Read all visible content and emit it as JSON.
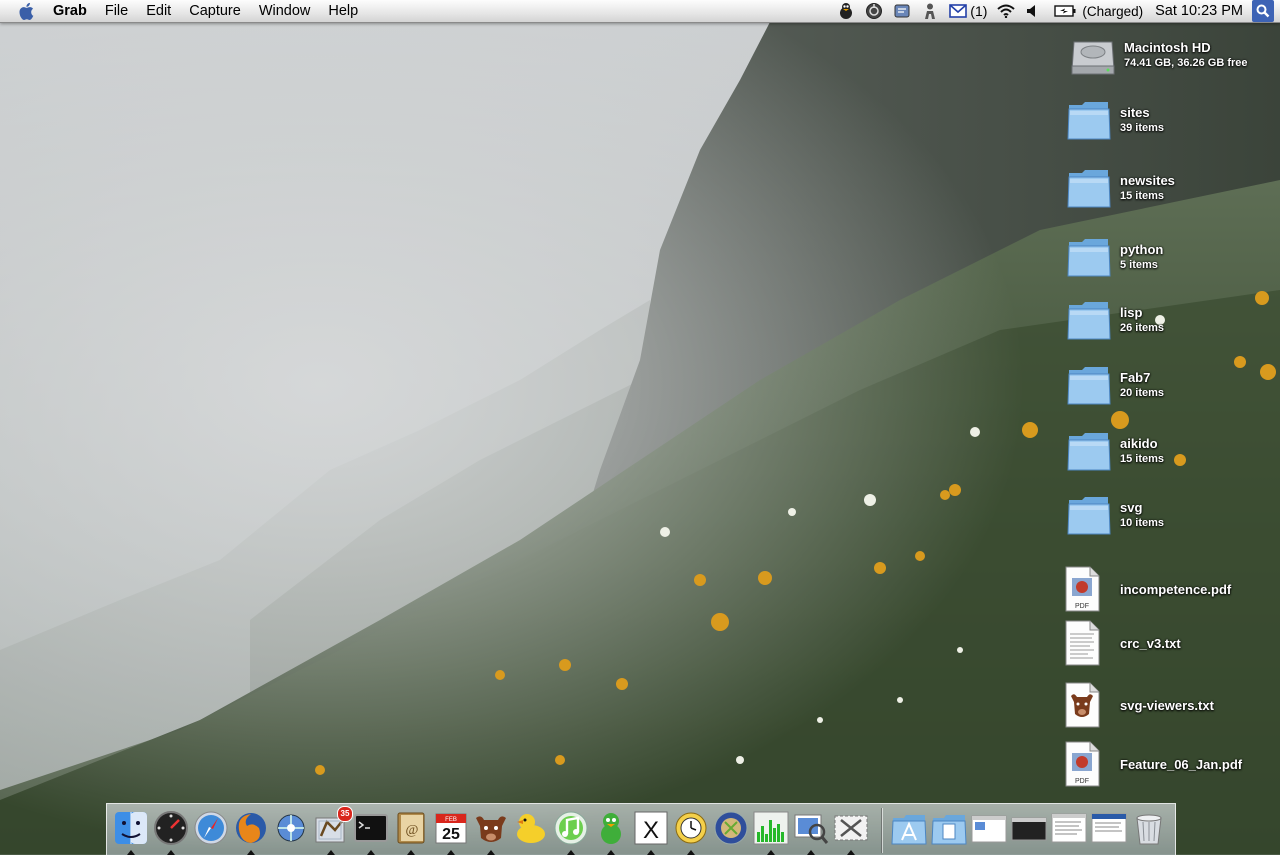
{
  "menubar": {
    "items": [
      "Grab",
      "File",
      "Edit",
      "Capture",
      "Window",
      "Help"
    ],
    "mail_count": "(1)",
    "battery_text": "(Charged)",
    "clock": "Sat 10:23 PM"
  },
  "desktop": {
    "drive": {
      "name": "Macintosh HD",
      "info": "74.41 GB, 36.26 GB free"
    },
    "folders": [
      {
        "name": "sites",
        "info": "39 items"
      },
      {
        "name": "newsites",
        "info": "15 items"
      },
      {
        "name": "python",
        "info": "5 items"
      },
      {
        "name": "lisp",
        "info": "26 items"
      },
      {
        "name": "Fab7",
        "info": "20 items"
      },
      {
        "name": "aikido",
        "info": "15 items"
      },
      {
        "name": "svg",
        "info": "10 items"
      }
    ],
    "files": [
      {
        "name": "incompetence.pdf",
        "icon": "pdf-icon",
        "badge": "PDF"
      },
      {
        "name": "crc_v3.txt",
        "icon": "text-file-icon"
      },
      {
        "name": "svg-viewers.txt",
        "icon": "bull-document-icon"
      },
      {
        "name": "Feature_06_Jan.pdf",
        "icon": "pdf-icon",
        "badge": "PDF"
      }
    ]
  },
  "dock": {
    "ical_month": "FEB",
    "ical_day": "25",
    "mail_badge": "35",
    "x11_label": "X",
    "apps": [
      "finder-icon",
      "dashboard-icon",
      "safari-icon",
      "firefox-icon",
      "network-utility-icon",
      "mail-icon",
      "terminal-icon",
      "address-book-icon",
      "ical-icon",
      "bull-app-icon",
      "cyberduck-icon",
      "itunes-icon",
      "adium-icon",
      "x11-icon",
      "activity-clock-icon",
      "script-editor-icon",
      "activity-monitor-icon",
      "preview-icon",
      "grab-icon"
    ],
    "docs": [
      "applications-folder-icon",
      "documents-folder-icon",
      "window-minimized-1",
      "window-minimized-2",
      "window-minimized-3",
      "window-minimized-4",
      "trash-icon"
    ]
  },
  "colors": {
    "folder_blue": "#8ec0ec",
    "menubar_bg": "#eaeaea",
    "spotlight_bg": "#3d63b5"
  }
}
